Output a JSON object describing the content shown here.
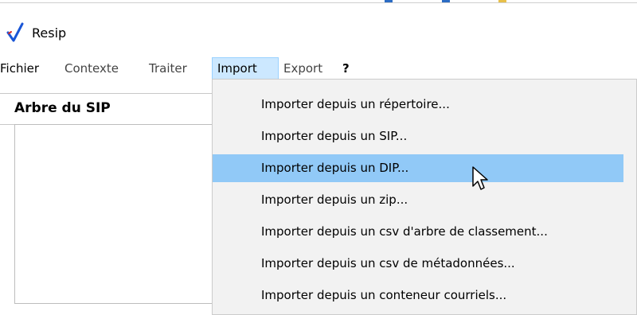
{
  "window": {
    "title": "Resip",
    "logo_icon": "checkmark-logo-icon"
  },
  "menubar": {
    "items": [
      "Fichier",
      "Contexte",
      "Traiter",
      "Import",
      "Export",
      "?"
    ],
    "active": "Import"
  },
  "panel": {
    "title": "Arbre du SIP"
  },
  "dropdown": {
    "items": [
      "Importer depuis un répertoire...",
      "Importer depuis un SIP...",
      "Importer depuis un DIP...",
      "Importer depuis un zip...",
      "Importer depuis un csv d'arbre de classement...",
      "Importer depuis un csv de métadonnées...",
      "Importer depuis un conteneur courriels..."
    ],
    "hovered": "Importer depuis un DIP..."
  },
  "colors": {
    "menu_active_bg": "#cce8ff",
    "hover_bg": "#91c9f7",
    "dropdown_bg": "#f2f2f2",
    "logo_check": "#1a56d6",
    "logo_tick": "#d62828"
  }
}
